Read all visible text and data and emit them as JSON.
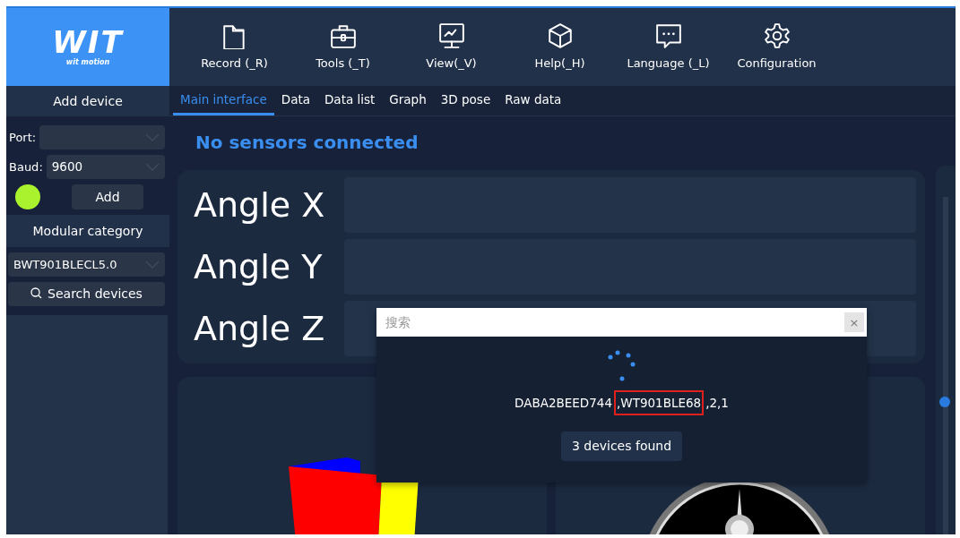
{
  "logo": {
    "wordmark": "WIT",
    "tagline": "wit motion"
  },
  "toolbar": [
    {
      "label": "Record (_R)",
      "kind": "folder"
    },
    {
      "label": "Tools (_T)",
      "kind": "toolbox"
    },
    {
      "label": "View(_V)",
      "kind": "monitor"
    },
    {
      "label": "Help(_H)",
      "kind": "cube"
    },
    {
      "label": "Language (_L)",
      "kind": "chat"
    },
    {
      "label": "Configuration",
      "kind": "gear"
    }
  ],
  "sidebar": {
    "header": "Add device",
    "port": {
      "label": "Port:"
    },
    "baud": {
      "label": "Baud:",
      "value": "9600"
    },
    "add_button": "Add",
    "category_header": "Modular category",
    "category": {
      "value": "BWT901BLECL5.0"
    },
    "search_button": "Search devices"
  },
  "tabs": [
    {
      "label": "Main interface",
      "selected": true
    },
    {
      "label": "Data",
      "selected": false
    },
    {
      "label": "Data list",
      "selected": false
    },
    {
      "label": "Graph",
      "selected": false
    },
    {
      "label": "3D pose",
      "selected": false
    },
    {
      "label": "Raw data",
      "selected": false
    }
  ],
  "status_message": "No sensors connected",
  "angles": [
    {
      "label": "Angle X"
    },
    {
      "label": "Angle Y"
    },
    {
      "label": "Angle Z"
    }
  ],
  "search_dialog": {
    "placeholder": "搜索",
    "close": "×",
    "device_info": [
      {
        "text": "DABA2BEED744",
        "highlighted": false
      },
      {
        "text": ",WT901BLE68",
        "highlighted": true
      },
      {
        "text": ",2,1",
        "highlighted": false
      }
    ],
    "found_button": "3 devices found"
  }
}
